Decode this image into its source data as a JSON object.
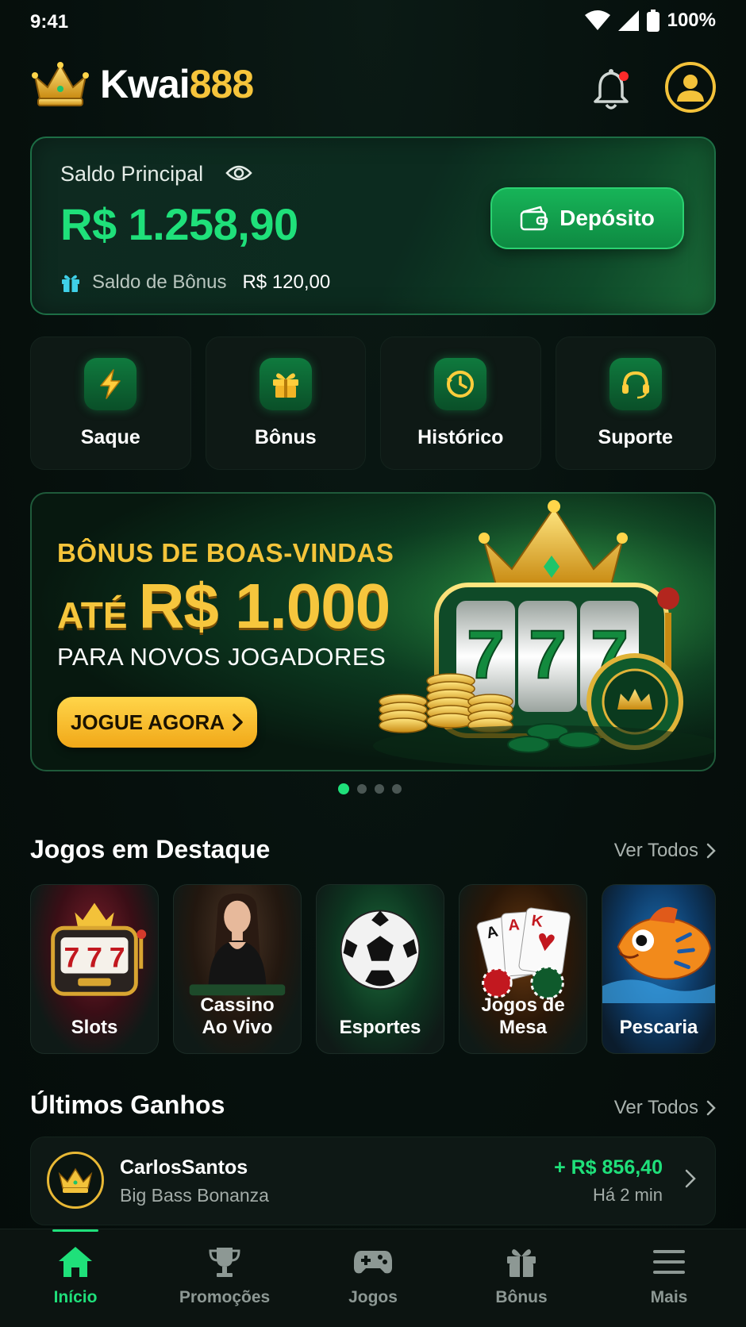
{
  "status_bar": {
    "time": "9:41",
    "battery": "100%"
  },
  "header": {
    "logo_part1": "Kwai",
    "logo_part2": "888",
    "has_notification": true
  },
  "balance": {
    "label": "Saldo Principal",
    "amount": "R$ 1.258,90",
    "bonus_label": "Saldo de Bônus",
    "bonus_value": "R$ 120,00",
    "deposit_label": "Depósito"
  },
  "quick_actions": [
    {
      "label": "Saque",
      "icon": "lightning-icon"
    },
    {
      "label": "Bônus",
      "icon": "gift-icon"
    },
    {
      "label": "Histórico",
      "icon": "clock-icon"
    },
    {
      "label": "Suporte",
      "icon": "headset-icon"
    }
  ],
  "banner": {
    "line1": "BÔNUS DE BOAS-VINDAS",
    "line2_prefix": "ATÉ",
    "line2_amount": "R$ 1.000",
    "line3": "PARA NOVOS JOGADORES",
    "cta": "JOGUE AGORA",
    "slide_count": 4,
    "active_slide": 1
  },
  "featured": {
    "title": "Jogos em Destaque",
    "link": "Ver Todos",
    "games": [
      {
        "label": "Slots",
        "icon": "slot-machine-icon"
      },
      {
        "label_line1": "Cassino",
        "label_line2": "Ao Vivo",
        "icon": "live-dealer-icon"
      },
      {
        "label": "Esportes",
        "icon": "soccer-ball-icon"
      },
      {
        "label": "Jogos de Mesa",
        "icon": "playing-cards-icon"
      },
      {
        "label": "Pescaria",
        "icon": "fish-icon"
      }
    ]
  },
  "wins": {
    "title": "Últimos Ganhos",
    "link": "Ver Todos",
    "items": [
      {
        "user": "CarlosSantos",
        "game": "Big Bass Bonanza",
        "amount": "+ R$ 856,40",
        "time": "Há 2 min"
      }
    ]
  },
  "bottom_nav": [
    {
      "label": "Início",
      "icon": "home-icon",
      "active": true
    },
    {
      "label": "Promoções",
      "icon": "trophy-icon",
      "active": false
    },
    {
      "label": "Jogos",
      "icon": "gamepad-icon",
      "active": false
    },
    {
      "label": "Bônus",
      "icon": "gift-icon",
      "active": false
    },
    {
      "label": "Mais",
      "icon": "menu-icon",
      "active": false
    }
  ],
  "colors": {
    "accent_green": "#1fe07a",
    "gold": "#f6c43b",
    "background": "#06100d"
  }
}
